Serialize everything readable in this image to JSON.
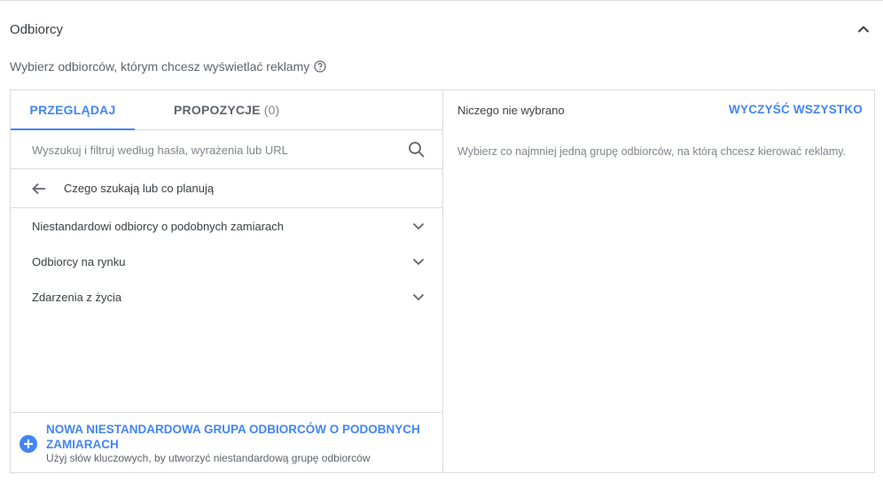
{
  "section": {
    "title": "Odbiorcy",
    "subtitle": "Wybierz odbiorców, którym chcesz wyświetlać reklamy"
  },
  "tabs": [
    {
      "label": "PRZEGLĄDAJ",
      "active": true
    },
    {
      "label": "PROPOZYCJE",
      "count": "(0)",
      "active": false
    }
  ],
  "search": {
    "value": "",
    "placeholder": "Wyszukuj i filtruj według hasła, wyrażenia lub URL"
  },
  "back": {
    "label": "Czego szukają lub co planują"
  },
  "categories": [
    {
      "label": "Niestandardowi odbiorcy o podobnych zamiarach"
    },
    {
      "label": "Odbiorcy na rynku"
    },
    {
      "label": "Zdarzenia z życia"
    }
  ],
  "footer": {
    "title": "NOWA NIESTANDARDOWA GRUPA ODBIORCÓW O PODOBNYCH ZAMIARACH",
    "description": "Użyj słów kluczowych, by utworzyć niestandardową grupę odbiorców"
  },
  "selection": {
    "status": "Niczego nie wybrano",
    "clear_label": "WYCZYŚĆ WSZYSTKO",
    "hint": "Wybierz co najmniej jedną grupę odbiorców, na którą chcesz kierować reklamy."
  },
  "colors": {
    "accent": "#4285f4",
    "text": "#3c4043",
    "muted": "#80868b",
    "border": "#dadce0"
  },
  "icons": {
    "collapse": "chevron-up-icon",
    "help": "help-circle-icon",
    "search": "search-icon",
    "back": "arrow-back-icon",
    "expand": "chevron-down-icon",
    "add": "add-circle-icon"
  }
}
